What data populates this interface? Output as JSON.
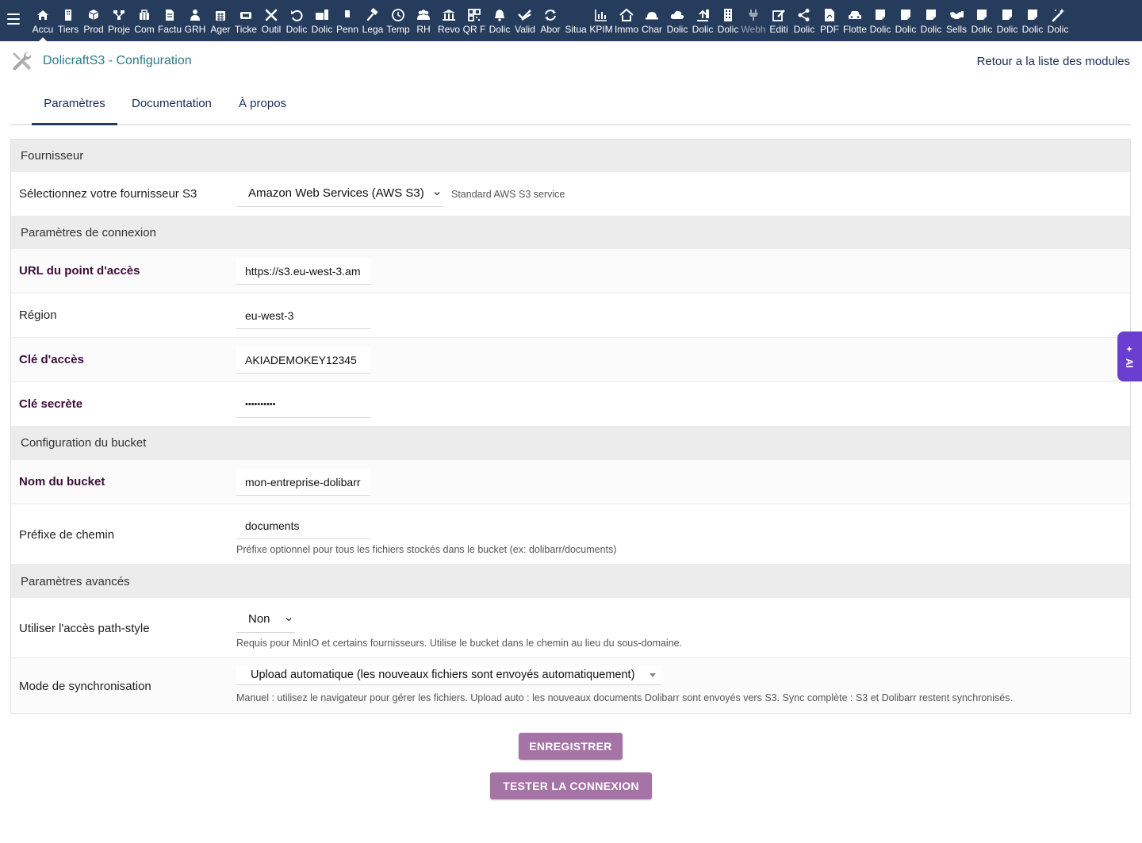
{
  "topbar": {
    "menu_icon": "hamburger-icon",
    "items": [
      {
        "label": "Accu",
        "icon": "home-icon"
      },
      {
        "label": "Tiers",
        "icon": "building-icon"
      },
      {
        "label": "Prod",
        "icon": "cube-icon"
      },
      {
        "label": "Proje",
        "icon": "project-icon"
      },
      {
        "label": "Com",
        "icon": "commerce-icon"
      },
      {
        "label": "Factu",
        "icon": "invoice-icon"
      },
      {
        "label": "GRH",
        "icon": "users-icon"
      },
      {
        "label": "Ager",
        "icon": "calendar-icon"
      },
      {
        "label": "Ticke",
        "icon": "ticket-icon"
      },
      {
        "label": "Outil",
        "icon": "tools-icon"
      },
      {
        "label": "Dolic",
        "icon": "undo-icon"
      },
      {
        "label": "Dolic",
        "icon": "briefcase-icon"
      },
      {
        "label": "Penn",
        "icon": "document-icon"
      },
      {
        "label": "Lega",
        "icon": "gavel-icon"
      },
      {
        "label": "Temp",
        "icon": "clock-icon"
      },
      {
        "label": "RH",
        "icon": "group-icon"
      },
      {
        "label": "Revo",
        "icon": "bank-icon"
      },
      {
        "label": "QR F",
        "icon": "qrcode-icon"
      },
      {
        "label": "Dolic",
        "icon": "bell-icon"
      },
      {
        "label": "Valid",
        "icon": "check-double-icon"
      },
      {
        "label": "Abor",
        "icon": "sync-icon"
      },
      {
        "label": "Situa",
        "icon": "blank-icon"
      },
      {
        "label": "KPIM",
        "icon": "chart-bar-icon"
      },
      {
        "label": "Immo",
        "icon": "house-icon"
      },
      {
        "label": "Char",
        "icon": "hardhat-icon"
      },
      {
        "label": "Dolic",
        "icon": "cloud-icon"
      },
      {
        "label": "Dolic",
        "icon": "upload-icon"
      },
      {
        "label": "Dolic",
        "icon": "office-building-icon"
      },
      {
        "label": "Webh",
        "icon": "plug-icon"
      },
      {
        "label": "Editi",
        "icon": "edit-icon"
      },
      {
        "label": "Dolic",
        "icon": "share-icon"
      },
      {
        "label": "PDF",
        "icon": "pdf-icon"
      },
      {
        "label": "Flotte",
        "icon": "car-icon"
      },
      {
        "label": "Dolic",
        "icon": "note-icon"
      },
      {
        "label": "Dolic",
        "icon": "note-icon"
      },
      {
        "label": "Dolic",
        "icon": "note-icon"
      },
      {
        "label": "Sells",
        "icon": "handshake-icon"
      },
      {
        "label": "Dolic",
        "icon": "note-icon"
      },
      {
        "label": "Dolic",
        "icon": "note-icon"
      },
      {
        "label": "Dolic",
        "icon": "note-icon"
      },
      {
        "label": "Dolic",
        "icon": "magic-wand-icon"
      }
    ]
  },
  "header": {
    "title": "DolicraftS3 - Configuration",
    "back_link": "Retour a la liste des modules",
    "icon": "tools-icon"
  },
  "tabs": [
    {
      "label": "Paramètres",
      "active": true
    },
    {
      "label": "Documentation",
      "active": false
    },
    {
      "label": "À propos",
      "active": false
    }
  ],
  "form": {
    "section_provider": "Fournisseur",
    "provider_label": "Sélectionnez votre fournisseur S3",
    "provider_value": "Amazon Web Services (AWS S3)",
    "provider_hint": "Standard AWS S3 service",
    "section_connection": "Paramètres de connexion",
    "endpoint_label": "URL du point d'accès",
    "endpoint_value": "https://s3.eu-west-3.am",
    "region_label": "Région",
    "region_value": "eu-west-3",
    "access_key_label": "Clé d'accès",
    "access_key_value": "AKIADEMOKEY12345",
    "secret_key_label": "Clé secrète",
    "secret_key_value": "••••••••••",
    "section_bucket": "Configuration du bucket",
    "bucket_label": "Nom du bucket",
    "bucket_value": "mon-entreprise-dolibarr",
    "prefix_label": "Préfixe de chemin",
    "prefix_value": "documents",
    "prefix_hint": "Préfixe optionnel pour tous les fichiers stockés dans le bucket (ex: dolibarr/documents)",
    "section_advanced": "Paramètres avancés",
    "path_style_label": "Utiliser l'accès path-style",
    "path_style_value": "Non",
    "path_style_hint": "Requis pour MinIO et certains fournisseurs. Utilise le bucket dans le chemin au lieu du sous-domaine.",
    "sync_label": "Mode de synchronisation",
    "sync_value": "Upload automatique (les nouveaux fichiers sont envoyés automatiquement)",
    "sync_hint": "Manuel : utilisez le navigateur pour gérer les fichiers. Upload auto : les nouveaux documents Dolibarr sont envoyés vers S3. Sync complète : S3 et Dolibarr restent synchronisés."
  },
  "buttons": {
    "save": "ENREGISTRER",
    "test": "TESTER LA CONNEXION"
  },
  "ai_tab": {
    "label": "AI",
    "icon": "sparkle-icon"
  },
  "colors": {
    "topbar": "#263c5c",
    "title": "#2b7d8a",
    "required_label": "#3e0c3a",
    "button": "#a573a5",
    "ai_tab": "#6a3fcf"
  }
}
